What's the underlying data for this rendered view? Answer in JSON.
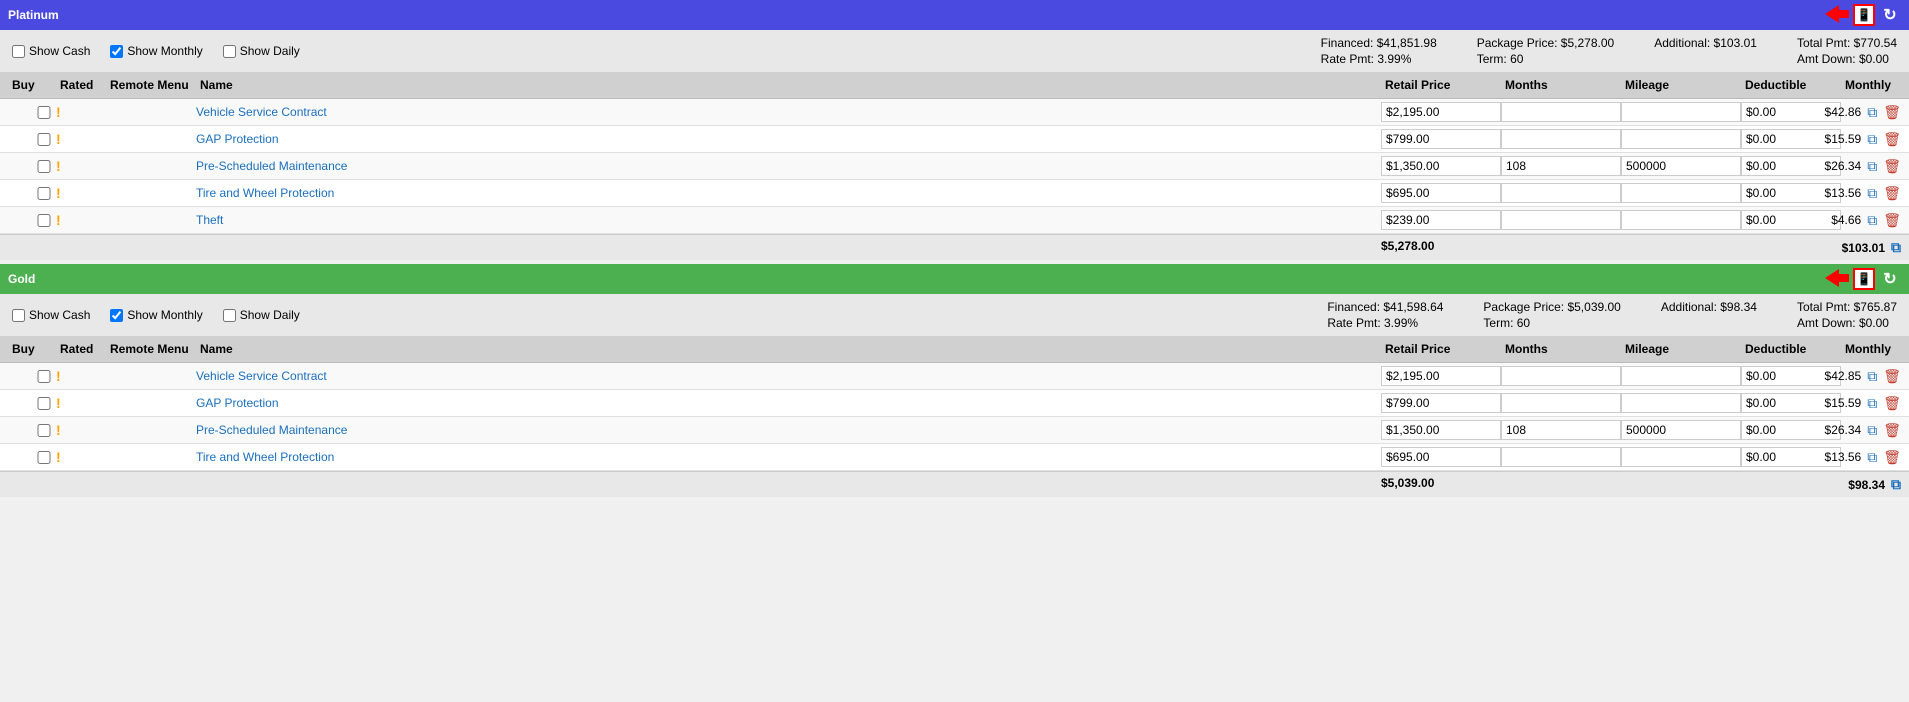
{
  "platinum": {
    "title": "Platinum",
    "header_class": "platinum",
    "controls": {
      "show_cash_label": "Show Cash",
      "show_monthly_label": "Show Monthly",
      "show_daily_label": "Show Daily",
      "show_monthly_checked": true,
      "financed": "Financed: $41,851.98",
      "rate_pmt": "Rate Pmt: 3.99%",
      "package_price": "Package Price: $5,278.00",
      "term": "Term: 60",
      "additional": "Additional: $103.01",
      "total_pmt": "Total Pmt: $770.54",
      "amt_down": "Amt Down: $0.00"
    },
    "columns": {
      "buy": "Buy",
      "rated": "Rated",
      "remote_menu": "Remote Menu",
      "name": "Name",
      "retail_price": "Retail Price",
      "months": "Months",
      "mileage": "Mileage",
      "deductible": "Deductible",
      "monthly": "Monthly"
    },
    "rows": [
      {
        "name": "Vehicle Service Contract",
        "retail_price": "$2,195.00",
        "months": "",
        "mileage": "",
        "deductible": "$0.00",
        "monthly": "$42.86"
      },
      {
        "name": "GAP Protection",
        "retail_price": "$799.00",
        "months": "",
        "mileage": "",
        "deductible": "$0.00",
        "monthly": "$15.59"
      },
      {
        "name": "Pre-Scheduled Maintenance",
        "retail_price": "$1,350.00",
        "months": "108",
        "mileage": "500000",
        "deductible": "$0.00",
        "monthly": "$26.34"
      },
      {
        "name": "Tire and Wheel Protection",
        "retail_price": "$695.00",
        "months": "",
        "mileage": "",
        "deductible": "$0.00",
        "monthly": "$13.56"
      },
      {
        "name": "Theft",
        "retail_price": "$239.00",
        "months": "",
        "mileage": "",
        "deductible": "$0.00",
        "monthly": "$4.66"
      }
    ],
    "totals": {
      "retail_price": "$5,278.00",
      "monthly": "$103.01"
    }
  },
  "gold": {
    "title": "Gold",
    "header_class": "gold",
    "controls": {
      "show_cash_label": "Show Cash",
      "show_monthly_label": "Show Monthly",
      "show_daily_label": "Show Daily",
      "show_monthly_checked": true,
      "financed": "Financed: $41,598.64",
      "rate_pmt": "Rate Pmt: 3.99%",
      "package_price": "Package Price: $5,039.00",
      "term": "Term: 60",
      "additional": "Additional: $98.34",
      "total_pmt": "Total Pmt: $765.87",
      "amt_down": "Amt Down: $0.00"
    },
    "columns": {
      "buy": "Buy",
      "rated": "Rated",
      "remote_menu": "Remote Menu",
      "name": "Name",
      "retail_price": "Retail Price",
      "months": "Months",
      "mileage": "Mileage",
      "deductible": "Deductible",
      "monthly": "Monthly"
    },
    "rows": [
      {
        "name": "Vehicle Service Contract",
        "retail_price": "$2,195.00",
        "months": "",
        "mileage": "",
        "deductible": "$0.00",
        "monthly": "$42.85"
      },
      {
        "name": "GAP Protection",
        "retail_price": "$799.00",
        "months": "",
        "mileage": "",
        "deductible": "$0.00",
        "monthly": "$15.59"
      },
      {
        "name": "Pre-Scheduled Maintenance",
        "retail_price": "$1,350.00",
        "months": "108",
        "mileage": "500000",
        "deductible": "$0.00",
        "monthly": "$26.34"
      },
      {
        "name": "Tire and Wheel Protection",
        "retail_price": "$695.00",
        "months": "",
        "mileage": "",
        "deductible": "$0.00",
        "monthly": "$13.56"
      }
    ],
    "totals": {
      "retail_price": "$5,039.00",
      "monthly": "$98.34"
    }
  },
  "icons": {
    "copy": "⧉",
    "delete": "🗑",
    "phone": "📱",
    "refresh": "↻",
    "warning": "!"
  }
}
